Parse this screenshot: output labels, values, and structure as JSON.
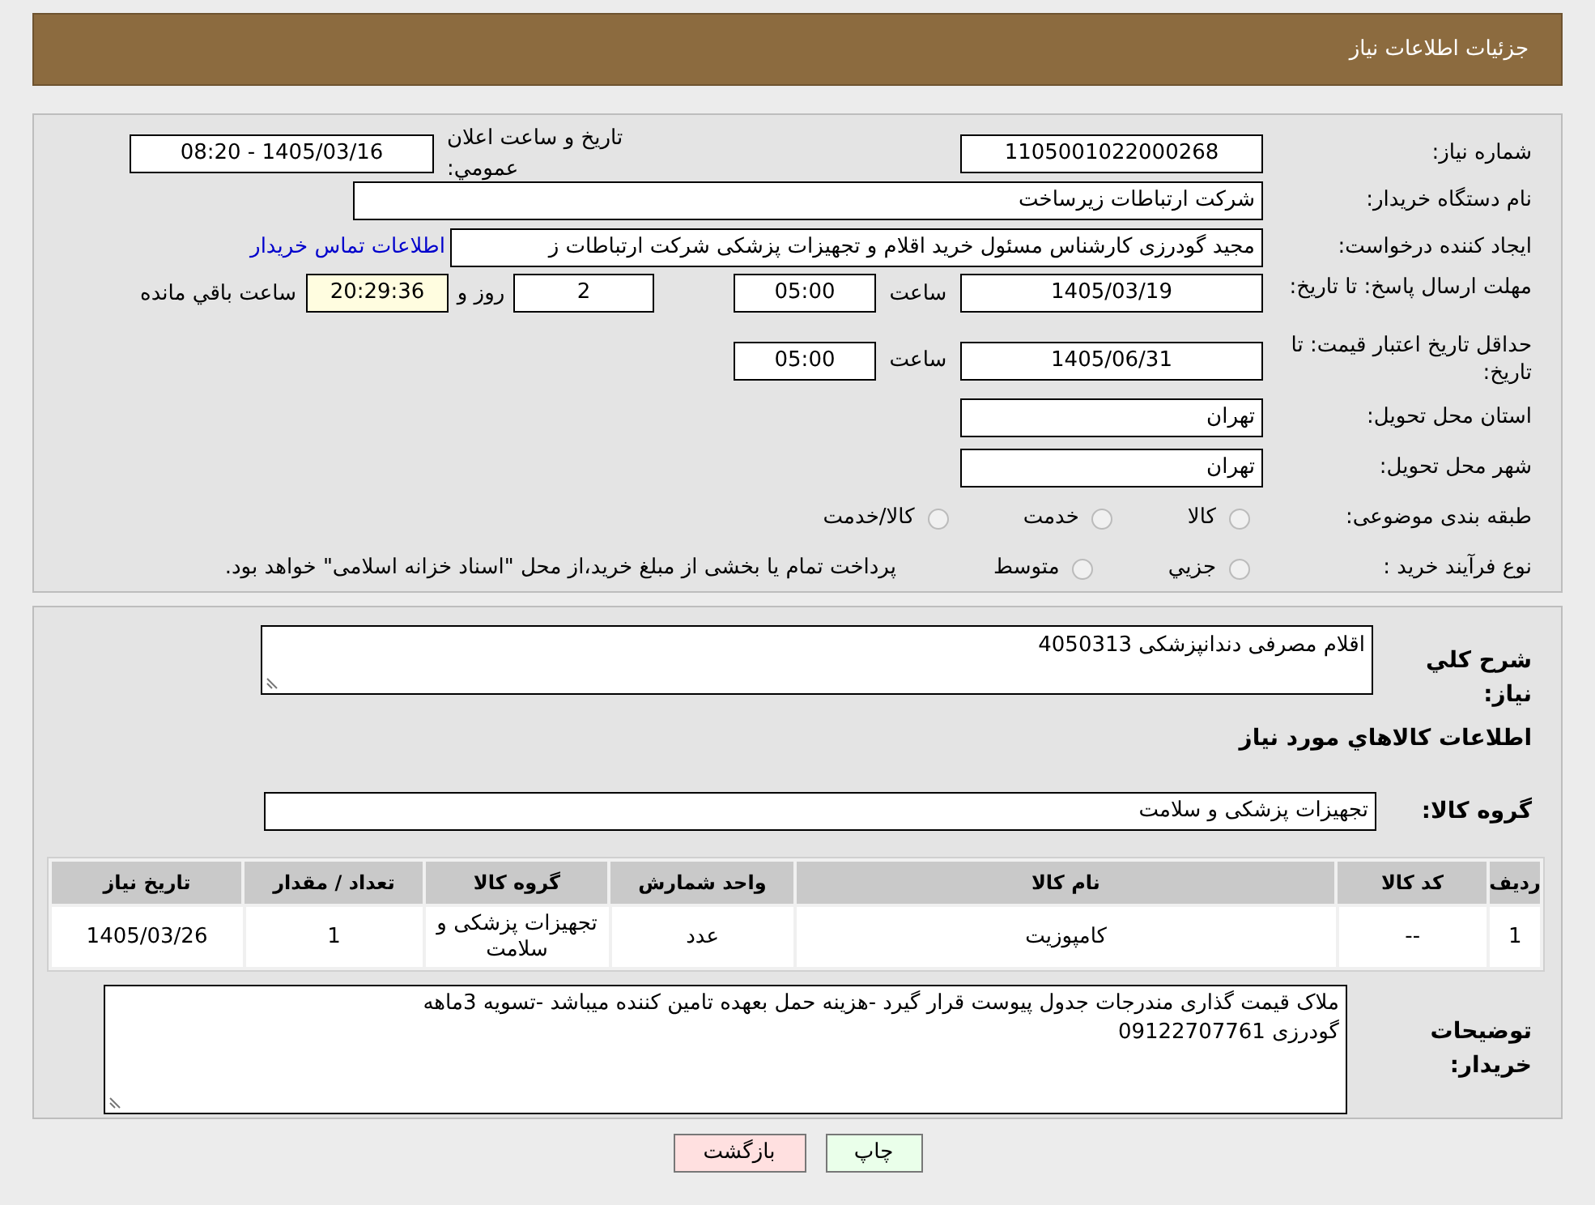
{
  "header": {
    "title": "جزئیات اطلاعات نیاز"
  },
  "need_info": {
    "need_number": {
      "label": "شماره نياز:",
      "value": "1105001022000268"
    },
    "announce_datetime": {
      "label": "تاريخ و ساعت اعلان عمومي:",
      "value": "1405/03/16 - 08:20"
    },
    "buyer_org": {
      "label": "نام دستگاه خريدار:",
      "value": "شركت ارتباطات زيرساخت"
    },
    "requester": {
      "label": "ايجاد كننده درخواست:",
      "value": "مجيد گودرزی كارشناس مسئول خريد اقلام و تجهيزات پزشكی شركت ارتباطات ز",
      "link": "اطلاعات تماس خريدار"
    },
    "response_deadline": {
      "label": "مهلت ارسال پاسخ: تا تاريخ:",
      "date": "1405/03/19",
      "time_label": "ساعت",
      "time": "05:00",
      "days": "2",
      "days_label": "روز و",
      "remaining": "20:29:36",
      "remaining_label": "ساعت باقي مانده"
    },
    "price_validity": {
      "label": "حداقل تاريخ اعتبار قيمت: تا تاريخ:",
      "date": "1405/06/31",
      "time_label": "ساعت",
      "time": "05:00"
    },
    "province": {
      "label": "استان محل تحويل:",
      "value": "تهران"
    },
    "city": {
      "label": "شهر محل تحويل:",
      "value": "تهران"
    },
    "category": {
      "label": "طبقه بندی موضوعی:",
      "options": [
        {
          "label": "كالا",
          "selected": false
        },
        {
          "label": "خدمت",
          "selected": false
        },
        {
          "label": "كالا/خدمت",
          "selected": false
        }
      ]
    },
    "process_type": {
      "label": "نوع فرآيند خريد :",
      "options": [
        {
          "label": "جزيي",
          "selected": false
        },
        {
          "label": "متوسط",
          "selected": false
        }
      ],
      "note": "پرداخت تمام يا بخشی از مبلغ خريد،از محل \"اسناد خزانه اسلامی\" خواهد بود."
    }
  },
  "goods": {
    "summary": {
      "label": "شرح كلي نياز:",
      "value": "اقلام مصرفی دندانپزشكی 4050313"
    },
    "heading": "اطلاعات كالاهاي مورد نياز",
    "group": {
      "label": "گروه كالا:",
      "value": "تجهيزات پزشكی و سلامت"
    },
    "table": {
      "columns": [
        "رديف",
        "كد كالا",
        "نام كالا",
        "واحد شمارش",
        "گروه كالا",
        "تعداد / مقدار",
        "تاريخ نياز"
      ],
      "rows": [
        [
          "1",
          "--",
          "كامپوزيت",
          "عدد",
          "تجهيزات پزشكی و سلامت",
          "1",
          "1405/03/26"
        ]
      ]
    },
    "buyer_notes": {
      "label": "توضيحات خريدار:",
      "lines": [
        "ملاک قيمت گذاری مندرجات جدول پيوست قرار گيرد -هزينه حمل بعهده تامين كننده ميباشد -تسويه 3ماهه",
        "گودرزی 09122707761"
      ]
    }
  },
  "buttons": [
    {
      "kind": "print",
      "label": "چاپ"
    },
    {
      "kind": "back",
      "label": "بازگشت"
    }
  ]
}
